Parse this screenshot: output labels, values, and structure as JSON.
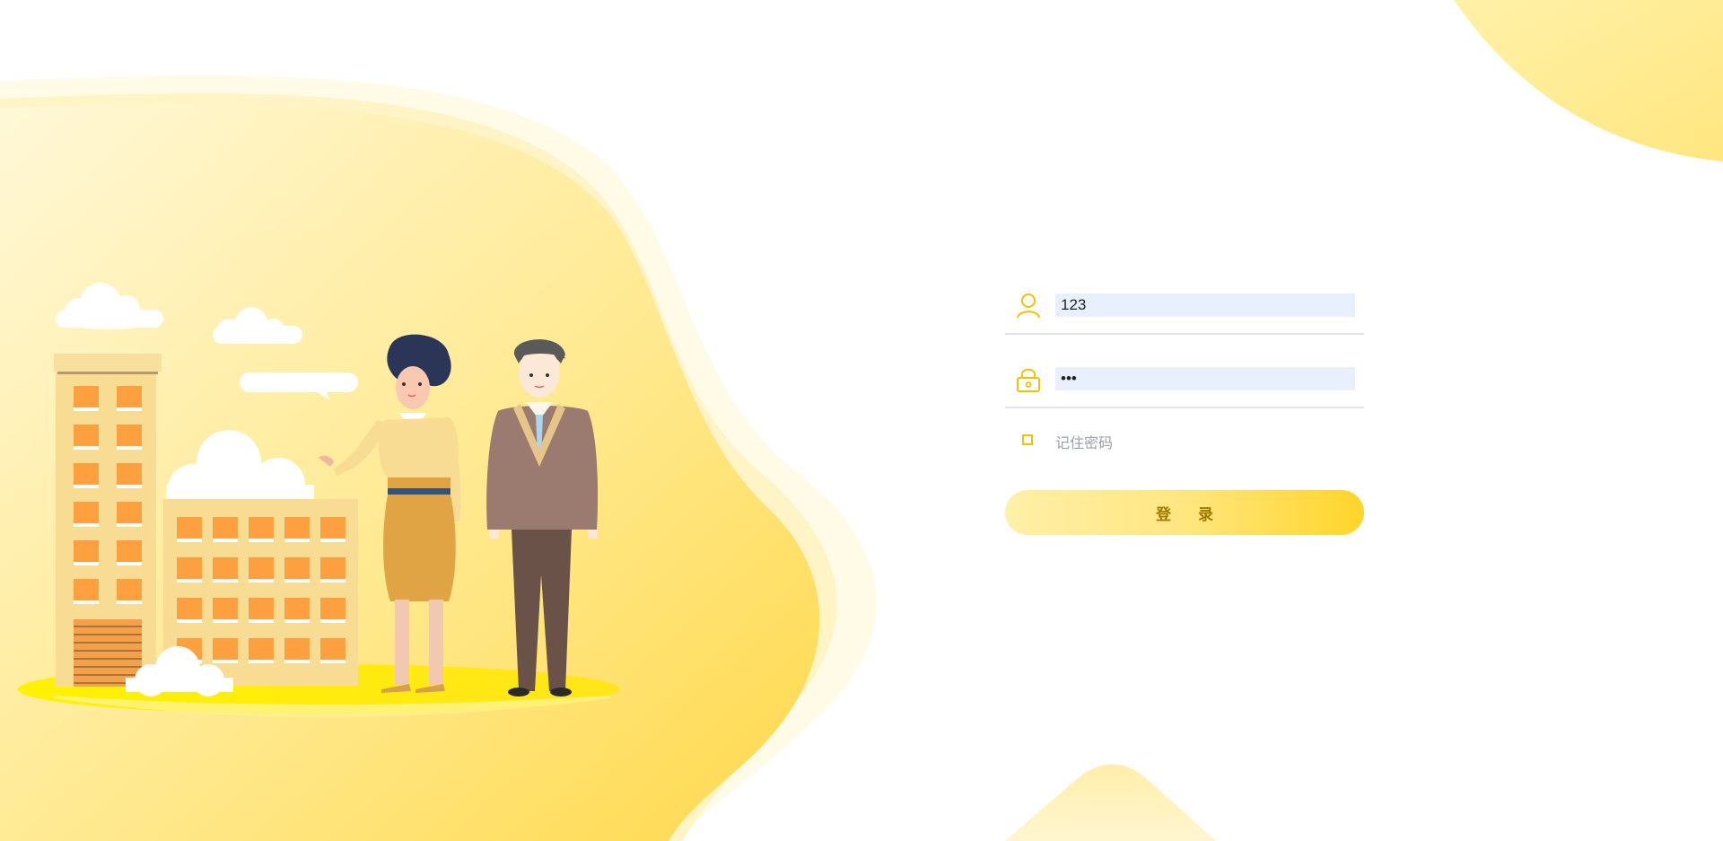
{
  "login": {
    "username_value": "123",
    "password_value": "•••",
    "remember_label": "记住密码",
    "submit_label": "登 录"
  },
  "icons": {
    "username": "user-icon",
    "password": "lock-icon",
    "remember": "checkbox-icon"
  },
  "colors": {
    "accent": "#f5c000",
    "button_gradient_start": "#fff0a8",
    "button_gradient_end": "#ffd52a",
    "button_text": "#a27a00",
    "input_bg": "#e8f0fe",
    "blob_light": "#fff6c8",
    "blob_mid": "#ffe37a",
    "window_orange": "#ffa040"
  }
}
